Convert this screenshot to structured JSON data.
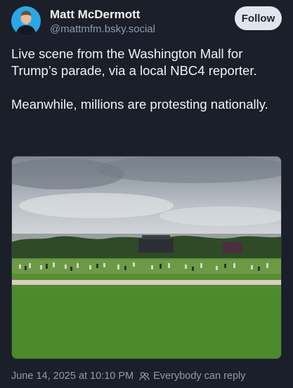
{
  "post": {
    "author": {
      "display_name": "Matt McDermott",
      "handle": "@mattmfm.bsky.social"
    },
    "follow_label": "Follow",
    "text": [
      "Live scene from the Washington Mall for Trump’s parade, via a local NBC4 reporter.",
      "Meanwhile, millions are protesting nationally."
    ],
    "timestamp": "June 14, 2025 at 10:10 PM",
    "reply_setting": "Everybody can reply",
    "icons": {
      "reply_setting": "people-icon"
    }
  },
  "colors": {
    "background": "#1a1f29",
    "text_primary": "#f1f3f5",
    "text_secondary": "#8e9bb0",
    "follow_button_bg": "#dfe5ec"
  }
}
